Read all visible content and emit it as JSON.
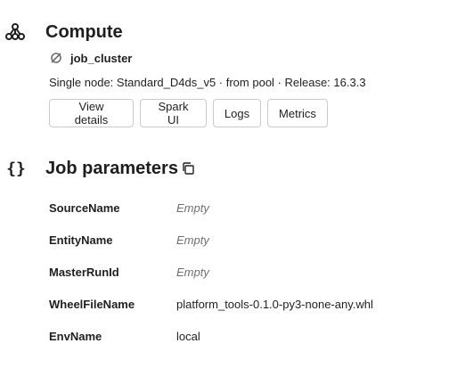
{
  "compute": {
    "title": "Compute",
    "icon": "cluster-hierarchy-icon",
    "cluster": {
      "icon": "cluster-off-icon",
      "name": "job_cluster",
      "description": "Single node: Standard_D4ds_v5 · from pool · Release: 16.3.3"
    },
    "buttons": [
      {
        "label": "View details"
      },
      {
        "label": "Spark UI"
      },
      {
        "label": "Logs"
      },
      {
        "label": "Metrics"
      }
    ]
  },
  "job_parameters": {
    "title": "Job parameters",
    "icon": "curly-braces-icon",
    "copy_icon": "copy-icon",
    "params": [
      {
        "key": "SourceName",
        "value": "Empty",
        "empty": true
      },
      {
        "key": "EntityName",
        "value": "Empty",
        "empty": true
      },
      {
        "key": "MasterRunId",
        "value": "Empty",
        "empty": true
      },
      {
        "key": "WheelFileName",
        "value": "platform_tools-0.1.0-py3-none-any.whl",
        "empty": false
      },
      {
        "key": "EnvName",
        "value": "local",
        "empty": false
      }
    ]
  }
}
